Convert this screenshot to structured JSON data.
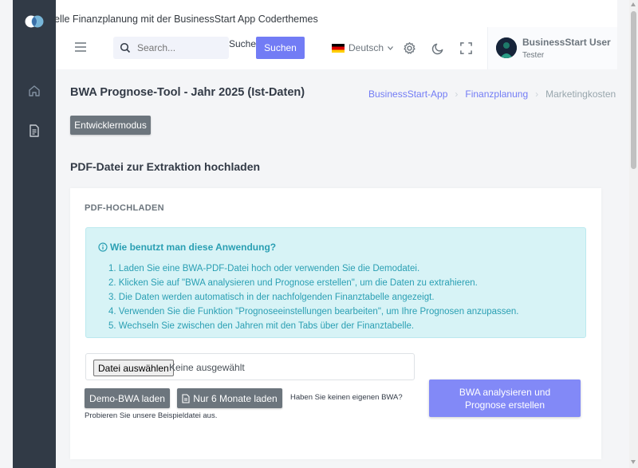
{
  "window_title": "elle Finanzplanung mit der BusinessStart App Coderthemes",
  "topbar": {
    "search_placeholder": "Search...",
    "search_label": "Suchen",
    "search_button": "Suchen",
    "language": "Deutsch",
    "user_name": "BusinessStart User",
    "user_role": "Tester"
  },
  "sidebar": {
    "items": [
      "home-icon",
      "document-icon"
    ]
  },
  "page": {
    "title": "BWA Prognose-Tool - Jahr 2025 (Ist-Daten)",
    "breadcrumb": [
      "BusinessStart-App",
      "Finanzplanung",
      "Marketingkosten"
    ],
    "dev_button": "Entwicklermodus",
    "section_title": "PDF-Datei zur Extraktion hochladen"
  },
  "card": {
    "header": "PDF-HOCHLADEN",
    "info_title": "Wie benutzt man diese Anwendung?",
    "steps": [
      "1. Laden Sie eine BWA-PDF-Datei hoch oder verwenden Sie die Demodatei.",
      "2. Klicken Sie auf \"BWA analysieren und Prognose erstellen\", um die Daten zu extrahieren.",
      "3. Die Daten werden automatisch in der nachfolgenden Finanztabelle angezeigt.",
      "4. Verwenden Sie die Funktion \"Prognoseeinstellungen bearbeiten\", um Ihre Prognosen anzupassen.",
      "5. Wechseln Sie zwischen den Jahren mit den Tabs über der Finanztabelle."
    ],
    "file_button": "Datei auswählen",
    "file_status": "Keine ausgewählt",
    "demo_button": "Demo-BWA laden",
    "six_months_button": "Nur 6 Monate laden",
    "demo_hint": "Haben Sie keinen eigenen BWA?",
    "demo_sub": "Probieren Sie unsere Beispieldatei aus.",
    "analyze_button": "BWA analysieren und Prognose erstellen"
  },
  "colors": {
    "sidebar": "#313a46",
    "primary": "#727cf5",
    "secondary": "#6c757d",
    "info_bg": "#d7f3f6",
    "info_text": "#2a9fb3"
  }
}
